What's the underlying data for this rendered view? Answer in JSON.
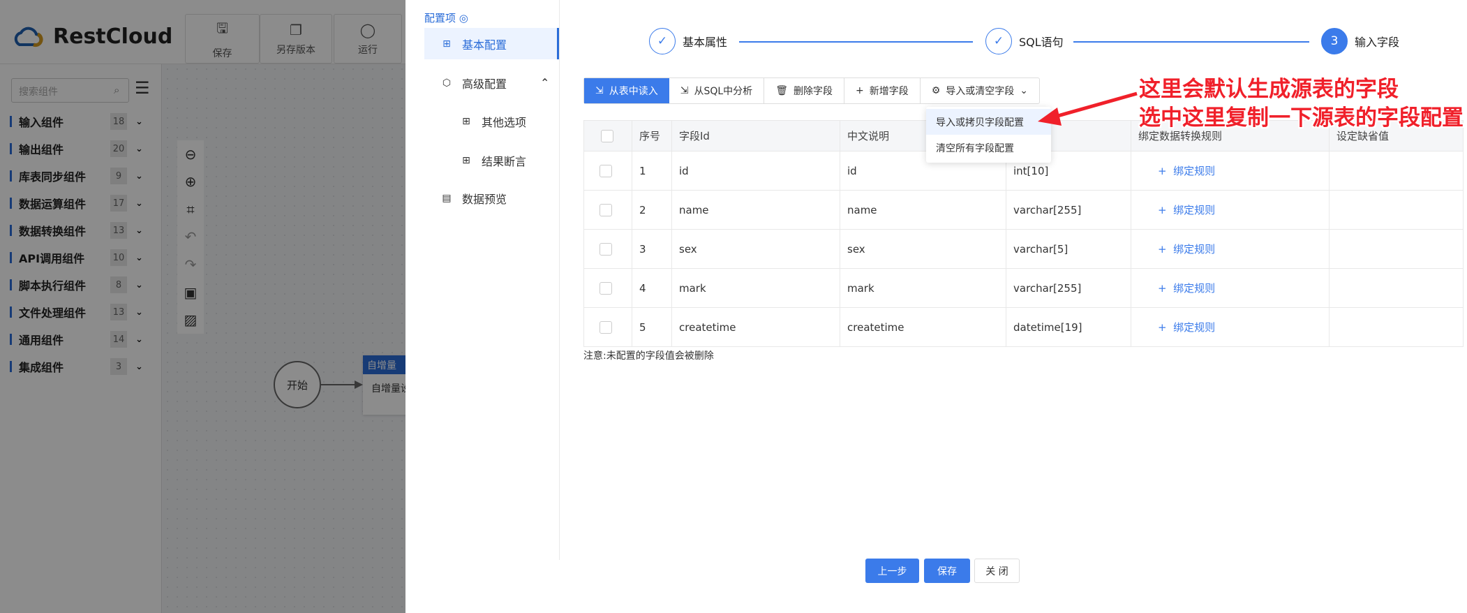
{
  "app": {
    "logo_text": "RestCloud",
    "toolbar": [
      {
        "label": "保存",
        "icon": "save-icon"
      },
      {
        "label": "另存版本",
        "icon": "copy-icon"
      },
      {
        "label": "运行",
        "icon": "run-icon"
      }
    ],
    "search_placeholder": "搜索组件",
    "categories": [
      {
        "label": "输入组件",
        "count": "18"
      },
      {
        "label": "输出组件",
        "count": "20"
      },
      {
        "label": "库表同步组件",
        "count": "9"
      },
      {
        "label": "数据运算组件",
        "count": "17"
      },
      {
        "label": "数据转换组件",
        "count": "13"
      },
      {
        "label": "API调用组件",
        "count": "10"
      },
      {
        "label": "脚本执行组件",
        "count": "8"
      },
      {
        "label": "文件处理组件",
        "count": "13"
      },
      {
        "label": "通用组件",
        "count": "14"
      },
      {
        "label": "集成组件",
        "count": "3"
      }
    ],
    "canvas": {
      "start_label": "开始",
      "node_title": "自增量",
      "node_body": "自增量设"
    }
  },
  "panel": {
    "title": "配置项",
    "menu": [
      {
        "label": "基本配置",
        "active": true
      },
      {
        "label": "高级配置"
      },
      {
        "label": "其他选项"
      },
      {
        "label": "结果断言"
      },
      {
        "label": "数据预览"
      }
    ],
    "steps": [
      {
        "label": "基本属性",
        "state": "done"
      },
      {
        "label": "SQL语句",
        "state": "done"
      },
      {
        "label": "输入字段",
        "number": "3",
        "state": "current"
      }
    ],
    "toolbar": [
      "从表中读入",
      "从SQL中分析",
      "删除字段",
      "新增字段",
      "导入或清空字段"
    ],
    "dropdown": [
      "导入或拷贝字段配置",
      "清空所有字段配置"
    ],
    "table": {
      "headers": [
        "序号",
        "字段Id",
        "中文说明",
        "",
        "绑定数据转换规则",
        "设定缺省值"
      ],
      "bind_label": "绑定规则",
      "rows": [
        {
          "no": "1",
          "id": "id",
          "desc": "id",
          "type": "int[10]"
        },
        {
          "no": "2",
          "id": "name",
          "desc": "name",
          "type": "varchar[255]"
        },
        {
          "no": "3",
          "id": "sex",
          "desc": "sex",
          "type": "varchar[5]"
        },
        {
          "no": "4",
          "id": "mark",
          "desc": "mark",
          "type": "varchar[255]"
        },
        {
          "no": "5",
          "id": "createtime",
          "desc": "createtime",
          "type": "datetime[19]"
        }
      ]
    },
    "note": "注意:未配置的字段值会被删除",
    "buttons": {
      "prev": "上一步",
      "save": "保存",
      "close": "关 闭"
    }
  },
  "annotation": {
    "line1": "这里会默认生成源表的字段",
    "line2": "选中这里复制一下源表的字段配置",
    "color": "#f0202a"
  }
}
